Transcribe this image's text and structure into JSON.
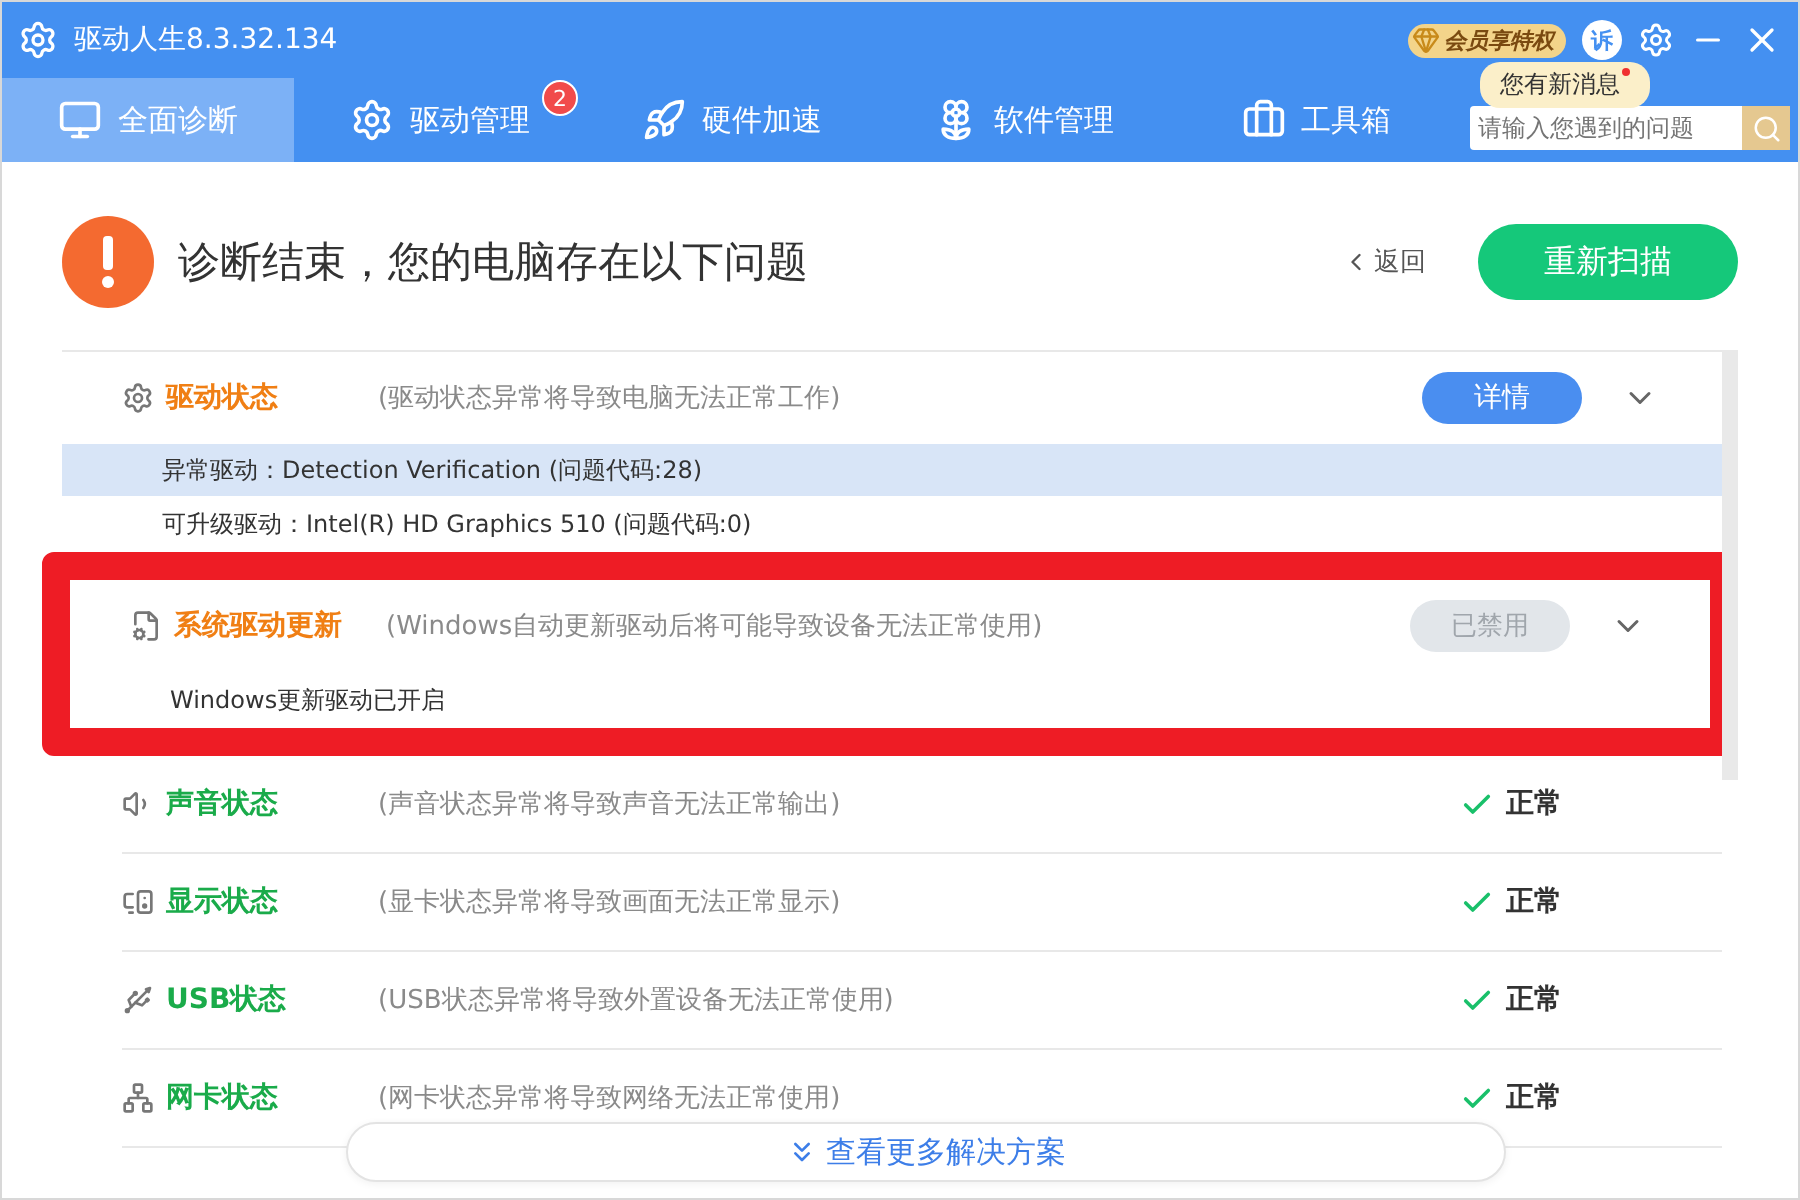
{
  "window": {
    "title": "驱动人生8.3.32.134",
    "vip_badge": "会员享特权",
    "service_label": "诉",
    "message_tooltip": "您有新消息",
    "unread": true
  },
  "tabs": [
    {
      "label": "全面诊断",
      "selected": true
    },
    {
      "label": "驱动管理",
      "selected": false,
      "badge": "2"
    },
    {
      "label": "硬件加速",
      "selected": false
    },
    {
      "label": "软件管理",
      "selected": false
    },
    {
      "label": "工具箱",
      "selected": false
    }
  ],
  "search": {
    "placeholder": "请输入您遇到的问题"
  },
  "header": {
    "title": "诊断结束，您的电脑存在以下问题",
    "back": "返回",
    "rescan": "重新扫描"
  },
  "sections": [
    {
      "name": "驱动状态",
      "description": "(驱动状态异常将导致电脑无法正常工作)",
      "status": {
        "kind": "button",
        "label": "详情"
      },
      "highlighted": false,
      "details": [
        {
          "text": "异常驱动：Detection Verification (问题代码:28)",
          "selected": true
        },
        {
          "text": "可升级驱动：Intel(R) HD Graphics 510 (问题代码:0)",
          "selected": false
        }
      ]
    },
    {
      "name": "系统驱动更新",
      "description": "(Windows自动更新驱动后将可能导致设备无法正常使用)",
      "status": {
        "kind": "disabled",
        "label": "已禁用"
      },
      "highlighted": true,
      "details": [
        {
          "text": "Windows更新驱动已开启",
          "selected": false
        }
      ]
    },
    {
      "name": "声音状态",
      "description": "(声音状态异常将导致声音无法正常输出)",
      "status": {
        "kind": "ok",
        "label": "正常"
      },
      "highlighted": false
    },
    {
      "name": "显示状态",
      "description": "(显卡状态异常将导致画面无法正常显示)",
      "status": {
        "kind": "ok",
        "label": "正常"
      },
      "highlighted": false
    },
    {
      "name": "USB状态",
      "description": "(USB状态异常将导致外置设备无法正常使用)",
      "status": {
        "kind": "ok",
        "label": "正常"
      },
      "highlighted": false
    },
    {
      "name": "网卡状态",
      "description": "(网卡状态异常将导致网络无法正常使用)",
      "status": {
        "kind": "ok",
        "label": "正常"
      },
      "highlighted": false
    }
  ],
  "more": "查看更多解决方案"
}
